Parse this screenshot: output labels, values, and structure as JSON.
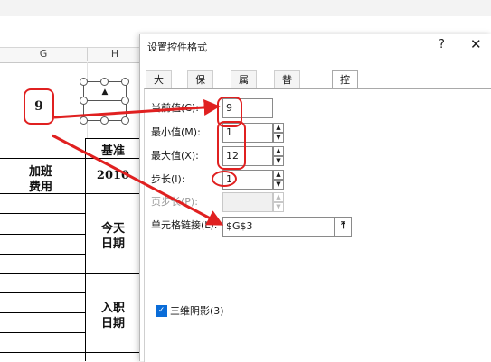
{
  "sheet": {
    "columns": [
      "G",
      "H"
    ],
    "cell_value": "9",
    "headers": {
      "baseline": "基准",
      "overtime_fee_l1": "加班",
      "overtime_fee_l2": "费用",
      "year": "2010",
      "today_l1": "今天",
      "today_l2": "日期",
      "hire_l1": "入职",
      "hire_l2": "日期"
    },
    "spinner": {
      "up_arrow": "▲",
      "down_arrow": "▼"
    }
  },
  "dialog": {
    "title": "设置控件格式",
    "help_label": "?",
    "close_label": "✕",
    "tabs": [
      {
        "label": "大小"
      },
      {
        "label": "保护"
      },
      {
        "label": "属性"
      },
      {
        "label": "替代文字"
      },
      {
        "label": "控制",
        "active": true
      }
    ],
    "fields": {
      "current_value": {
        "label": "当前值(C):",
        "value": "9"
      },
      "min_value": {
        "label": "最小值(M):",
        "value": "1"
      },
      "max_value": {
        "label": "最大值(X):",
        "value": "12"
      },
      "step": {
        "label": "步长(I):",
        "value": "1"
      },
      "page_step": {
        "label": "页步长(P):",
        "value": ""
      },
      "cell_link": {
        "label": "单元格链接(L):",
        "value": "$G$3"
      }
    },
    "shading_3d": {
      "label": "三维阴影(3)",
      "checked": true
    }
  },
  "colors": {
    "annotation_red": "#e02020",
    "checkbox_blue": "#0a6cd8"
  },
  "icons": {
    "collapse_button": "collapse-range-icon",
    "spin_up": "spin-up-icon",
    "spin_down": "spin-down-icon"
  }
}
